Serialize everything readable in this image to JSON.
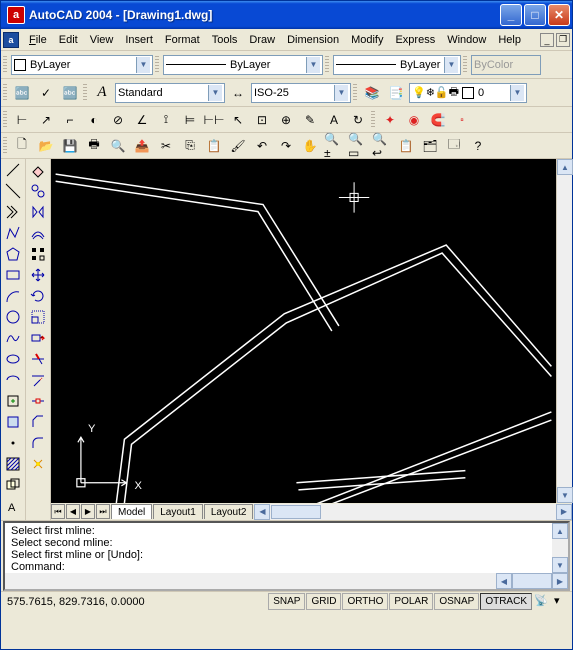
{
  "title": "AutoCAD 2004 - [Drawing1.dwg]",
  "app_icon_letter": "a",
  "menus": {
    "file": "File",
    "edit": "Edit",
    "view": "View",
    "insert": "Insert",
    "format": "Format",
    "tools": "Tools",
    "draw": "Draw",
    "dimension": "Dimension",
    "modify": "Modify",
    "express": "Express",
    "window": "Window",
    "help": "Help"
  },
  "properties_bar": {
    "layer_color": "ByLayer",
    "linetype": "ByLayer",
    "lineweight": "ByLayer",
    "plot_style": "ByColor"
  },
  "style_bar": {
    "text_style": "Standard",
    "dim_style": "ISO-25",
    "layer_status": "0"
  },
  "layout_tabs": {
    "model": "Model",
    "l1": "Layout1",
    "l2": "Layout2"
  },
  "command_lines": [
    "Select first mline:",
    "Select second mline:",
    "Select first mline or [Undo]:",
    "Command:"
  ],
  "coords": "575.7615, 829.7316, 0.0000",
  "status_btns": {
    "snap": "SNAP",
    "grid": "GRID",
    "ortho": "ORTHO",
    "polar": "POLAR",
    "osnap": "OSNAP",
    "otrack": "OTRACK"
  },
  "axis": {
    "x": "X",
    "y": "Y"
  }
}
